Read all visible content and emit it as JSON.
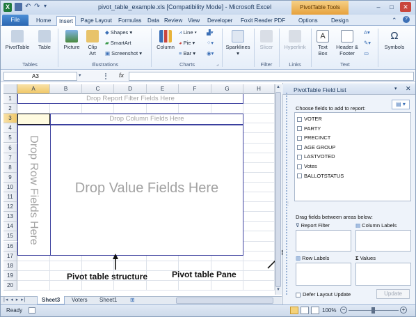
{
  "app": {
    "window_title": "pivot_table_example.xls  [Compatibility Mode]  -  Microsoft Excel",
    "context_tab_group": "PivotTable Tools"
  },
  "ribbon_tabs": [
    "File",
    "Home",
    "Insert",
    "Page Layout",
    "Formulas",
    "Data",
    "Review",
    "View",
    "Developer",
    "Foxit Reader PDF",
    "Options",
    "Design"
  ],
  "ribbon": {
    "tables": {
      "label": "Tables",
      "pivottable": "PivotTable",
      "table": "Table"
    },
    "illustrations": {
      "label": "Illustrations",
      "picture": "Picture",
      "clipart": "Clip Art",
      "shapes": "Shapes",
      "smartart": "SmartArt",
      "screenshot": "Screenshot"
    },
    "charts": {
      "label": "Charts",
      "column": "Column",
      "line": "Line",
      "pie": "Pie",
      "bar": "Bar"
    },
    "sparklines": {
      "label": "",
      "button": "Sparklines"
    },
    "filter": {
      "label": "Filter",
      "slicer": "Slicer"
    },
    "links": {
      "label": "Links",
      "hyperlink": "Hyperlink"
    },
    "text": {
      "label": "Text",
      "textbox": "Text Box",
      "header_footer": "Header & Footer"
    },
    "symbols": {
      "label": "",
      "button": "Symbols"
    }
  },
  "formula_bar": {
    "name_box": "A3",
    "fx": "fx",
    "value": ""
  },
  "columns": [
    "A",
    "B",
    "C",
    "D",
    "E",
    "F",
    "G",
    "H"
  ],
  "rows": [
    "1",
    "2",
    "3",
    "4",
    "5",
    "6",
    "7",
    "8",
    "9",
    "10",
    "11",
    "12",
    "13",
    "14",
    "15",
    "16",
    "17",
    "18",
    "19",
    "20"
  ],
  "pivot": {
    "report_filter": "Drop Report Filter Fields Here",
    "column_fields": "Drop Column Fields Here",
    "row_fields": "Drop Row Fields Here",
    "value_fields": "Drop Value Fields Here"
  },
  "annotations": {
    "structure": "Pivot table structure",
    "pane": "Pivot table Pane"
  },
  "field_list": {
    "title": "PivotTable Field List",
    "choose_label": "Choose fields to add to report:",
    "fields": [
      "VOTER",
      "PARTY",
      "PRECINCT",
      "AGE GROUP",
      "LASTVOTED",
      "Votes",
      "BALLOTSTATUS"
    ],
    "drag_label": "Drag fields between areas below:",
    "areas": {
      "report_filter": "Report Filter",
      "column_labels": "Column Labels",
      "row_labels": "Row Labels",
      "values": "Values"
    },
    "defer_label": "Defer Layout Update",
    "update_button": "Update"
  },
  "sheet_tabs": [
    "Sheet3",
    "Voters",
    "Sheet1"
  ],
  "status": {
    "ready": "Ready",
    "zoom": "100%"
  }
}
